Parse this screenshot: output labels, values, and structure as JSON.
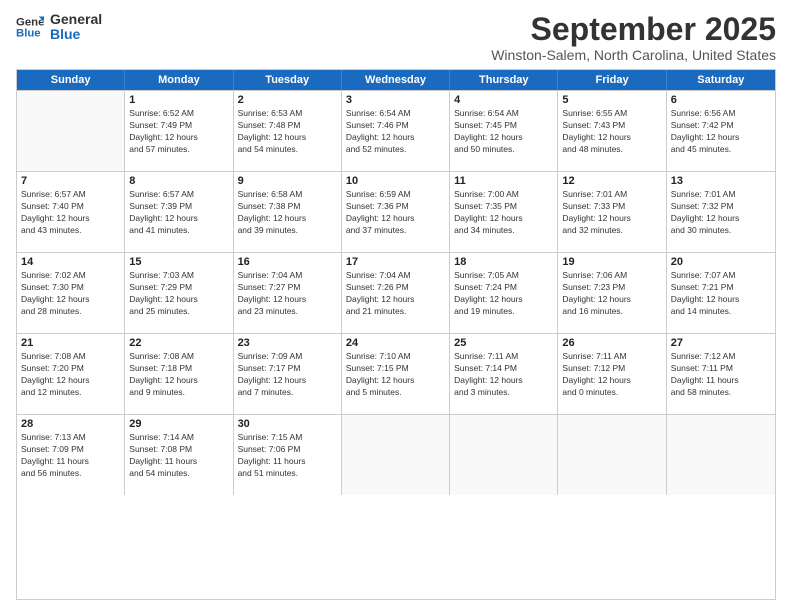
{
  "logo": {
    "general": "General",
    "blue": "Blue"
  },
  "header": {
    "month": "September 2025",
    "location": "Winston-Salem, North Carolina, United States"
  },
  "days_of_week": [
    "Sunday",
    "Monday",
    "Tuesday",
    "Wednesday",
    "Thursday",
    "Friday",
    "Saturday"
  ],
  "weeks": [
    [
      {
        "day": null,
        "info": null
      },
      {
        "day": "1",
        "info": "Sunrise: 6:52 AM\nSunset: 7:49 PM\nDaylight: 12 hours\nand 57 minutes."
      },
      {
        "day": "2",
        "info": "Sunrise: 6:53 AM\nSunset: 7:48 PM\nDaylight: 12 hours\nand 54 minutes."
      },
      {
        "day": "3",
        "info": "Sunrise: 6:54 AM\nSunset: 7:46 PM\nDaylight: 12 hours\nand 52 minutes."
      },
      {
        "day": "4",
        "info": "Sunrise: 6:54 AM\nSunset: 7:45 PM\nDaylight: 12 hours\nand 50 minutes."
      },
      {
        "day": "5",
        "info": "Sunrise: 6:55 AM\nSunset: 7:43 PM\nDaylight: 12 hours\nand 48 minutes."
      },
      {
        "day": "6",
        "info": "Sunrise: 6:56 AM\nSunset: 7:42 PM\nDaylight: 12 hours\nand 45 minutes."
      }
    ],
    [
      {
        "day": "7",
        "info": "Sunrise: 6:57 AM\nSunset: 7:40 PM\nDaylight: 12 hours\nand 43 minutes."
      },
      {
        "day": "8",
        "info": "Sunrise: 6:57 AM\nSunset: 7:39 PM\nDaylight: 12 hours\nand 41 minutes."
      },
      {
        "day": "9",
        "info": "Sunrise: 6:58 AM\nSunset: 7:38 PM\nDaylight: 12 hours\nand 39 minutes."
      },
      {
        "day": "10",
        "info": "Sunrise: 6:59 AM\nSunset: 7:36 PM\nDaylight: 12 hours\nand 37 minutes."
      },
      {
        "day": "11",
        "info": "Sunrise: 7:00 AM\nSunset: 7:35 PM\nDaylight: 12 hours\nand 34 minutes."
      },
      {
        "day": "12",
        "info": "Sunrise: 7:01 AM\nSunset: 7:33 PM\nDaylight: 12 hours\nand 32 minutes."
      },
      {
        "day": "13",
        "info": "Sunrise: 7:01 AM\nSunset: 7:32 PM\nDaylight: 12 hours\nand 30 minutes."
      }
    ],
    [
      {
        "day": "14",
        "info": "Sunrise: 7:02 AM\nSunset: 7:30 PM\nDaylight: 12 hours\nand 28 minutes."
      },
      {
        "day": "15",
        "info": "Sunrise: 7:03 AM\nSunset: 7:29 PM\nDaylight: 12 hours\nand 25 minutes."
      },
      {
        "day": "16",
        "info": "Sunrise: 7:04 AM\nSunset: 7:27 PM\nDaylight: 12 hours\nand 23 minutes."
      },
      {
        "day": "17",
        "info": "Sunrise: 7:04 AM\nSunset: 7:26 PM\nDaylight: 12 hours\nand 21 minutes."
      },
      {
        "day": "18",
        "info": "Sunrise: 7:05 AM\nSunset: 7:24 PM\nDaylight: 12 hours\nand 19 minutes."
      },
      {
        "day": "19",
        "info": "Sunrise: 7:06 AM\nSunset: 7:23 PM\nDaylight: 12 hours\nand 16 minutes."
      },
      {
        "day": "20",
        "info": "Sunrise: 7:07 AM\nSunset: 7:21 PM\nDaylight: 12 hours\nand 14 minutes."
      }
    ],
    [
      {
        "day": "21",
        "info": "Sunrise: 7:08 AM\nSunset: 7:20 PM\nDaylight: 12 hours\nand 12 minutes."
      },
      {
        "day": "22",
        "info": "Sunrise: 7:08 AM\nSunset: 7:18 PM\nDaylight: 12 hours\nand 9 minutes."
      },
      {
        "day": "23",
        "info": "Sunrise: 7:09 AM\nSunset: 7:17 PM\nDaylight: 12 hours\nand 7 minutes."
      },
      {
        "day": "24",
        "info": "Sunrise: 7:10 AM\nSunset: 7:15 PM\nDaylight: 12 hours\nand 5 minutes."
      },
      {
        "day": "25",
        "info": "Sunrise: 7:11 AM\nSunset: 7:14 PM\nDaylight: 12 hours\nand 3 minutes."
      },
      {
        "day": "26",
        "info": "Sunrise: 7:11 AM\nSunset: 7:12 PM\nDaylight: 12 hours\nand 0 minutes."
      },
      {
        "day": "27",
        "info": "Sunrise: 7:12 AM\nSunset: 7:11 PM\nDaylight: 11 hours\nand 58 minutes."
      }
    ],
    [
      {
        "day": "28",
        "info": "Sunrise: 7:13 AM\nSunset: 7:09 PM\nDaylight: 11 hours\nand 56 minutes."
      },
      {
        "day": "29",
        "info": "Sunrise: 7:14 AM\nSunset: 7:08 PM\nDaylight: 11 hours\nand 54 minutes."
      },
      {
        "day": "30",
        "info": "Sunrise: 7:15 AM\nSunset: 7:06 PM\nDaylight: 11 hours\nand 51 minutes."
      },
      {
        "day": null,
        "info": null
      },
      {
        "day": null,
        "info": null
      },
      {
        "day": null,
        "info": null
      },
      {
        "day": null,
        "info": null
      }
    ]
  ]
}
